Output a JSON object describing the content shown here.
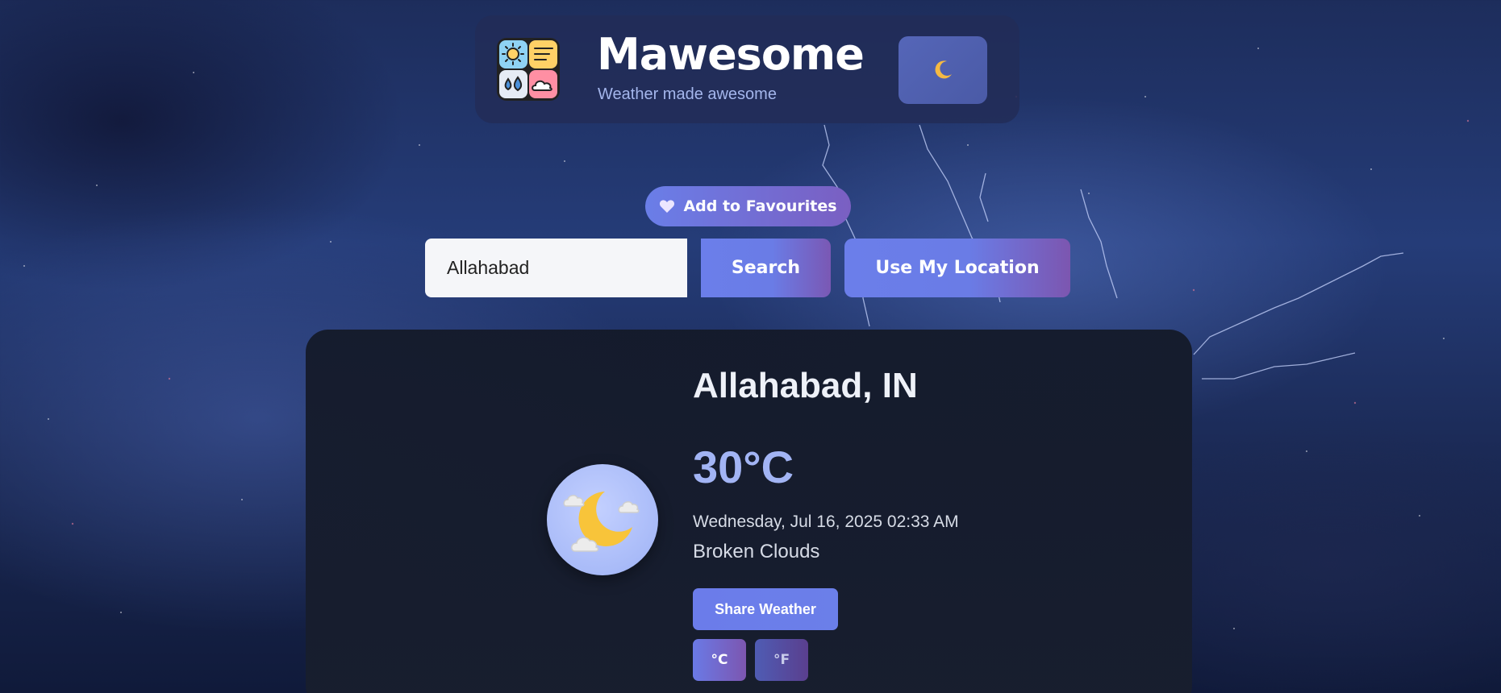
{
  "header": {
    "app_name": "Mawesome",
    "tagline": "Weather made awesome",
    "logo_icon": "weather-tiles-logo",
    "theme_toggle_icon": "crescent-moon-icon"
  },
  "favourites": {
    "label": "Add to Favourites",
    "icon": "heart-icon"
  },
  "search": {
    "value": "Allahabad",
    "search_label": "Search",
    "location_label": "Use My Location"
  },
  "weather": {
    "city": "Allahabad, IN",
    "temperature": "30°C",
    "datetime": "Wednesday, Jul 16, 2025 02:33 AM",
    "condition": "Broken Clouds",
    "condition_icon": "moon-with-clouds-icon",
    "share_label": "Share Weather",
    "unit_celsius": "°C",
    "unit_fahrenheit": "°F",
    "active_unit": "°C"
  },
  "colors": {
    "accent": "#6b7eea",
    "accent_end": "#7a58b4",
    "temperature": "#a2b4f4",
    "card_bg": "#161c2c",
    "header_bg": "#222c58"
  }
}
